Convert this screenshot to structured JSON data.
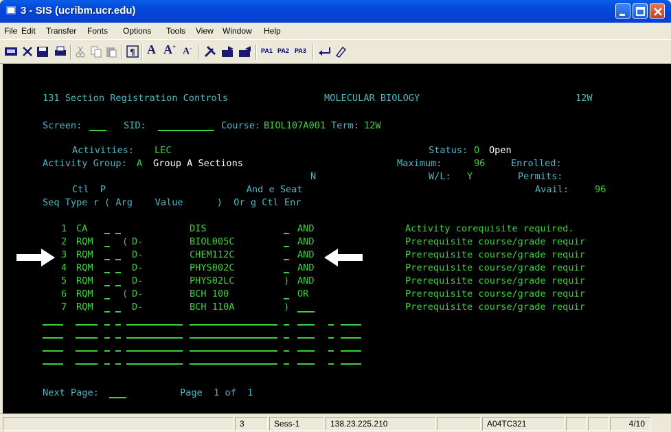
{
  "window": {
    "title": "3 - SIS (ucribm.ucr.edu)"
  },
  "menu": [
    "File",
    "Edit",
    "Transfer",
    "Fonts",
    "Options",
    "Tools",
    "View",
    "Window",
    "Help"
  ],
  "toolbar": {
    "pa1": "PA1",
    "pa2": "PA2",
    "pa3": "PA3"
  },
  "terminal": {
    "header_title": "131 Section Registration Controls",
    "header_dept": "MOLECULAR BIOLOGY",
    "header_term": "12W",
    "screen_label": "Screen:",
    "screen_value": "",
    "sid_label": "SID:",
    "sid_value": "",
    "course_label": "Course:",
    "course_value": "BIOL107A001",
    "term_label": "Term:",
    "term_value": "12W",
    "activities_label": "Activities:",
    "activities_value": "LEC",
    "status_label": "Status:",
    "status_code": "O",
    "status_text": "Open",
    "actgroup_label": "Activity Group:",
    "actgroup_value": "A",
    "actgroup_desc": "Group A Sections",
    "maximum_label": "Maximum:",
    "maximum_value": "96",
    "enrolled_label": "Enrolled:",
    "enrolled_value": "",
    "wl_label": "W/L:",
    "wl_value": "Y",
    "permits_label": "Permits:",
    "permits_value": "",
    "avail_label": "Avail:",
    "avail_value": "96",
    "col_n": "N",
    "col_header1": "Ctl  P                         And e Seat",
    "col_header2": "Seq Type r ( Arg    Value      )  Or g Ctl Enr",
    "rows": [
      {
        "seq": "1",
        "type": "CA",
        "paren": "",
        "arg": "",
        "value": "DIS",
        "close": "",
        "andor": "AND",
        "msg": "Activity corequisite required."
      },
      {
        "seq": "2",
        "type": "RQM",
        "paren": "(",
        "arg": "D-",
        "value": "BIOL005C",
        "close": "",
        "andor": "AND",
        "msg": "Prerequisite course/grade requir"
      },
      {
        "seq": "3",
        "type": "RQM",
        "paren": "",
        "arg": "D-",
        "value": "CHEM112C",
        "close": "",
        "andor": "AND",
        "msg": "Prerequisite course/grade requir"
      },
      {
        "seq": "4",
        "type": "RQM",
        "paren": "",
        "arg": "D-",
        "value": "PHYS002C",
        "close": "",
        "andor": "AND",
        "msg": "Prerequisite course/grade requir"
      },
      {
        "seq": "5",
        "type": "RQM",
        "paren": "",
        "arg": "D-",
        "value": "PHYS02LC",
        "close": ")",
        "andor": "AND",
        "msg": "Prerequisite course/grade requir"
      },
      {
        "seq": "6",
        "type": "RQM",
        "paren": "(",
        "arg": "D-",
        "value": "BCH 100",
        "close": "",
        "andor": "OR",
        "msg": "Prerequisite course/grade requir"
      },
      {
        "seq": "7",
        "type": "RQM",
        "paren": "",
        "arg": "D-",
        "value": "BCH 110A",
        "close": ")",
        "andor": "",
        "msg": "Prerequisite course/grade requir"
      }
    ],
    "next_page_label": "Next Page:",
    "page_label": "Page  1 of  1"
  },
  "statusbar": {
    "cell1": "3",
    "cell2": "Sess-1",
    "cell3": "138.23.225.210",
    "cell4": "A04TC321",
    "cell5": "4/10"
  },
  "colors": {
    "terminal_bg": "#000000",
    "label_cyan": "#4fb6c7",
    "field_green": "#3cd23c",
    "title_blue": "#0347d8"
  }
}
